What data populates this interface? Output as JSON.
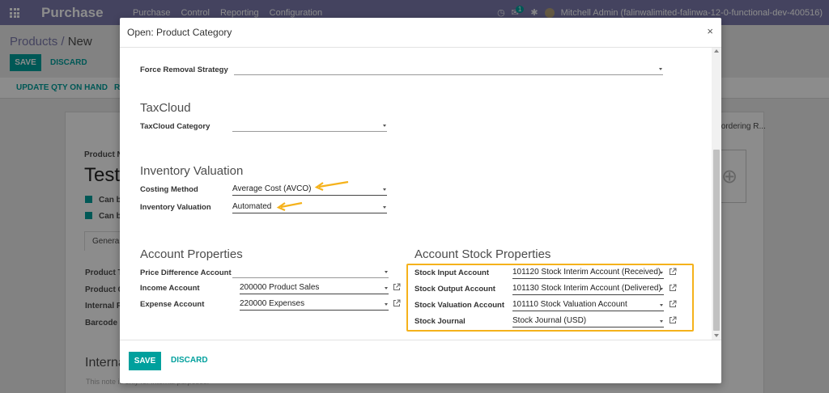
{
  "app": {
    "title": "Purchase",
    "menu": [
      "Purchase",
      "Control",
      "Reporting",
      "Configuration"
    ],
    "message_count": "1",
    "user": "Mitchell Admin (falinwalimited-falinwa-12-0-functional-dev-400516)"
  },
  "breadcrumb": {
    "parent": "Products",
    "separator": "/",
    "current": "New"
  },
  "bg_form": {
    "save_label": "SAVE",
    "discard_label": "DISCARD",
    "update_qty_label": "UPDATE QTY ON HAND",
    "r_label": "R",
    "product_name_label": "Product N",
    "product_name_value": "Test",
    "can_be_1": "Can b",
    "can_be_2": "Can b",
    "tab_general": "General",
    "product_type": "Product T",
    "product_category": "Product C",
    "internal_ref": "Internal R",
    "barcode": "Barcode",
    "internal_notes": "Interna",
    "notes_placeholder": "This note is only for internal purposes.",
    "reordering": "Reordering R..."
  },
  "modal": {
    "title": "Open: Product Category",
    "close": "×",
    "save_label": "SAVE",
    "discard_label": "DISCARD",
    "force_removal": {
      "label": "Force Removal Strategy",
      "value": ""
    },
    "taxcloud_section": "TaxCloud",
    "taxcloud_category": {
      "label": "TaxCloud Category",
      "value": ""
    },
    "inventory_valuation_section": "Inventory Valuation",
    "costing_method": {
      "label": "Costing Method",
      "value": "Average Cost (AVCO)"
    },
    "inventory_valuation": {
      "label": "Inventory Valuation",
      "value": "Automated"
    },
    "account_properties_section": "Account Properties",
    "price_difference": {
      "label": "Price Difference Account",
      "value": ""
    },
    "income_account": {
      "label": "Income Account",
      "value": "200000 Product Sales"
    },
    "expense_account": {
      "label": "Expense Account",
      "value": "220000 Expenses"
    },
    "account_stock_section": "Account Stock Properties",
    "stock_input": {
      "label": "Stock Input Account",
      "value": "101120 Stock Interim Account (Received)"
    },
    "stock_output": {
      "label": "Stock Output Account",
      "value": "101130 Stock Interim Account (Delivered)"
    },
    "stock_valuation": {
      "label": "Stock Valuation Account",
      "value": "101110 Stock Valuation Account"
    },
    "stock_journal": {
      "label": "Stock Journal",
      "value": "Stock Journal (USD)"
    }
  },
  "colors": {
    "brand": "#7c7bad",
    "accent": "#00a09d",
    "highlight": "#f5b21b"
  }
}
